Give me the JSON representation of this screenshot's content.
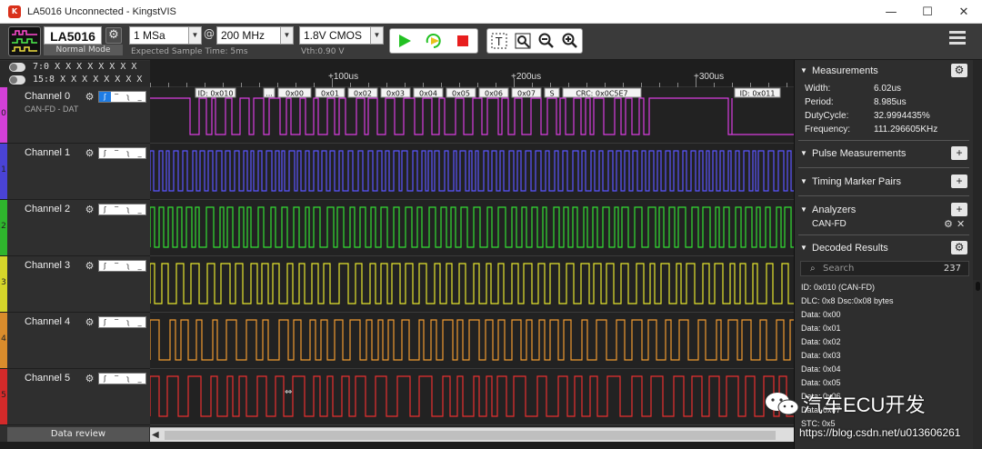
{
  "window": {
    "title": "LA5016 Unconnected - KingstVIS",
    "icon_text": "K",
    "controls": [
      "—",
      "☐",
      "✕"
    ]
  },
  "toolbar": {
    "device_name": "LA5016",
    "device_mode": "Normal Mode",
    "sample_depth": "1 MSa",
    "at_symbol": "@",
    "sample_rate": "200 MHz",
    "expected_time": "Expected Sample Time: 5ms",
    "voltage": "1.8V CMOS",
    "vth": "Vth:0.90 V"
  },
  "groups": [
    {
      "label": "7:0 X X X X X X X X"
    },
    {
      "label": "15:8 X X X X X X X X"
    }
  ],
  "channels": [
    {
      "name": "Channel 0",
      "index": "0",
      "desc": "CAN-FD - DAT",
      "color": "#d340d8",
      "trace": "#d83ee0"
    },
    {
      "name": "Channel 1",
      "index": "1",
      "desc": "",
      "color": "#4a43d6",
      "trace": "#5a55ff"
    },
    {
      "name": "Channel 2",
      "index": "2",
      "desc": "",
      "color": "#2fb52d",
      "trace": "#33e033"
    },
    {
      "name": "Channel 3",
      "index": "3",
      "desc": "",
      "color": "#d6d62a",
      "trace": "#e6e62e"
    },
    {
      "name": "Channel 4",
      "index": "4",
      "desc": "",
      "color": "#d98c2c",
      "trace": "#f09a30"
    },
    {
      "name": "Channel 5",
      "index": "5",
      "desc": "",
      "color": "#d32a2a",
      "trace": "#e83030"
    }
  ],
  "trigger_buttons": [
    "ʃ",
    "‾",
    "ʅ",
    "_"
  ],
  "ruler": {
    "ticks": [
      "+100us",
      "+200us",
      "+300us"
    ]
  },
  "decode_labels": [
    "ID: 0x010",
    "...",
    "0x00",
    "0x01",
    "0x02",
    "0x03",
    "0x04",
    "0x05",
    "0x06",
    "0x07",
    "S",
    "CRC: 0x0C5E7",
    "ID: 0x011"
  ],
  "data_review": "Data review",
  "right": {
    "measurements": {
      "title": "Measurements",
      "rows": [
        {
          "k": "Width:",
          "v": "6.02us"
        },
        {
          "k": "Period:",
          "v": "8.985us"
        },
        {
          "k": "DutyCycle:",
          "v": "32.9994435%"
        },
        {
          "k": "Frequency:",
          "v": "111.296605KHz"
        }
      ]
    },
    "pulse_title": "Pulse Measurements",
    "timing_title": "Timing Marker Pairs",
    "analyzers": {
      "title": "Analyzers",
      "items": [
        "CAN-FD"
      ]
    },
    "decoded": {
      "title": "Decoded Results",
      "search_placeholder": "Search",
      "count": "237",
      "rows": [
        "ID: 0x010 (CAN-FD)",
        "DLC: 0x8 Dsc:0x08 bytes",
        "Data: 0x00",
        "Data: 0x01",
        "Data: 0x02",
        "Data: 0x03",
        "Data: 0x04",
        "Data: 0x05",
        "Data: 0x06",
        "Data: 0x07",
        "STC: 0x5"
      ]
    }
  },
  "watermark": {
    "brand": "汽车ECU开发",
    "url": "https://blog.csdn.net/u013606261"
  }
}
